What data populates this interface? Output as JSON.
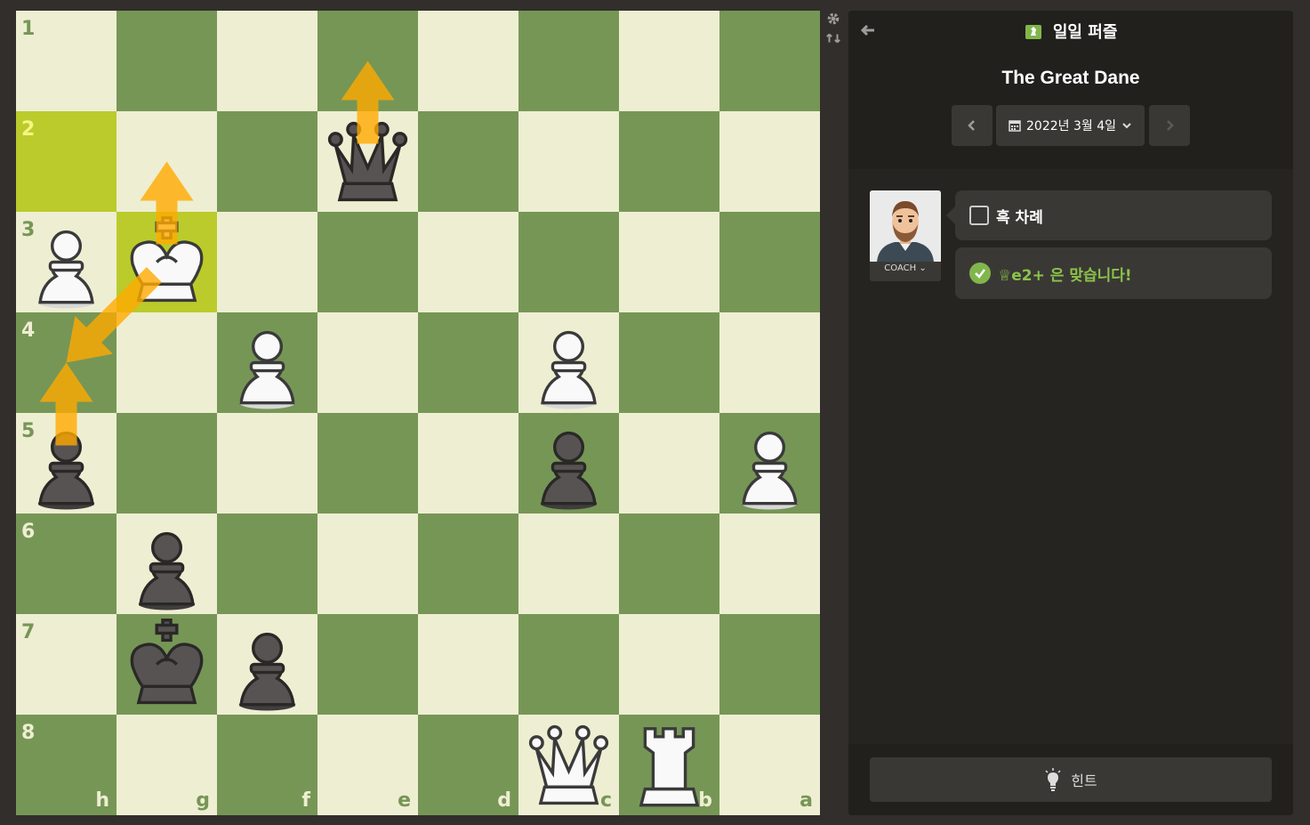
{
  "board": {
    "ranks": [
      "1",
      "2",
      "3",
      "4",
      "5",
      "6",
      "7",
      "8"
    ],
    "files": [
      "h",
      "g",
      "f",
      "e",
      "d",
      "c",
      "b",
      "a"
    ],
    "highlighted_squares": [
      "h2",
      "g3"
    ],
    "pieces": [
      {
        "square": "e2",
        "piece": "black-queen"
      },
      {
        "square": "h3",
        "piece": "white-pawn"
      },
      {
        "square": "g3",
        "piece": "white-king"
      },
      {
        "square": "f4",
        "piece": "white-pawn"
      },
      {
        "square": "c4",
        "piece": "white-pawn"
      },
      {
        "square": "h5",
        "piece": "black-pawn"
      },
      {
        "square": "c5",
        "piece": "black-pawn"
      },
      {
        "square": "a5",
        "piece": "white-pawn"
      },
      {
        "square": "g6",
        "piece": "black-pawn"
      },
      {
        "square": "g7",
        "piece": "black-king"
      },
      {
        "square": "f7",
        "piece": "black-pawn"
      },
      {
        "square": "c8",
        "piece": "white-queen"
      },
      {
        "square": "b8",
        "piece": "white-rook"
      }
    ],
    "arrows": [
      {
        "from": "e2",
        "to": "e1"
      },
      {
        "from": "g3",
        "to": "g2"
      },
      {
        "from": "g3",
        "to": "h4"
      },
      {
        "from": "h5",
        "to": "h4"
      }
    ],
    "colors": {
      "light": "#eeeed2",
      "dark": "#769656",
      "highlight": "#bbcb2b",
      "arrow": "#ffaa00"
    }
  },
  "side_tools": {
    "settings_icon": "gear-icon",
    "flip_icon": "flip-board-icon"
  },
  "panel": {
    "header_title": "일일 퍼즐",
    "puzzle_name": "The Great Dane",
    "date": "2022년 3월 4일",
    "coach_label": "COACH",
    "turn_text": "흑 차례",
    "result_text": "♕e2+ 은 맞습니다!",
    "hint_label": "힌트"
  }
}
